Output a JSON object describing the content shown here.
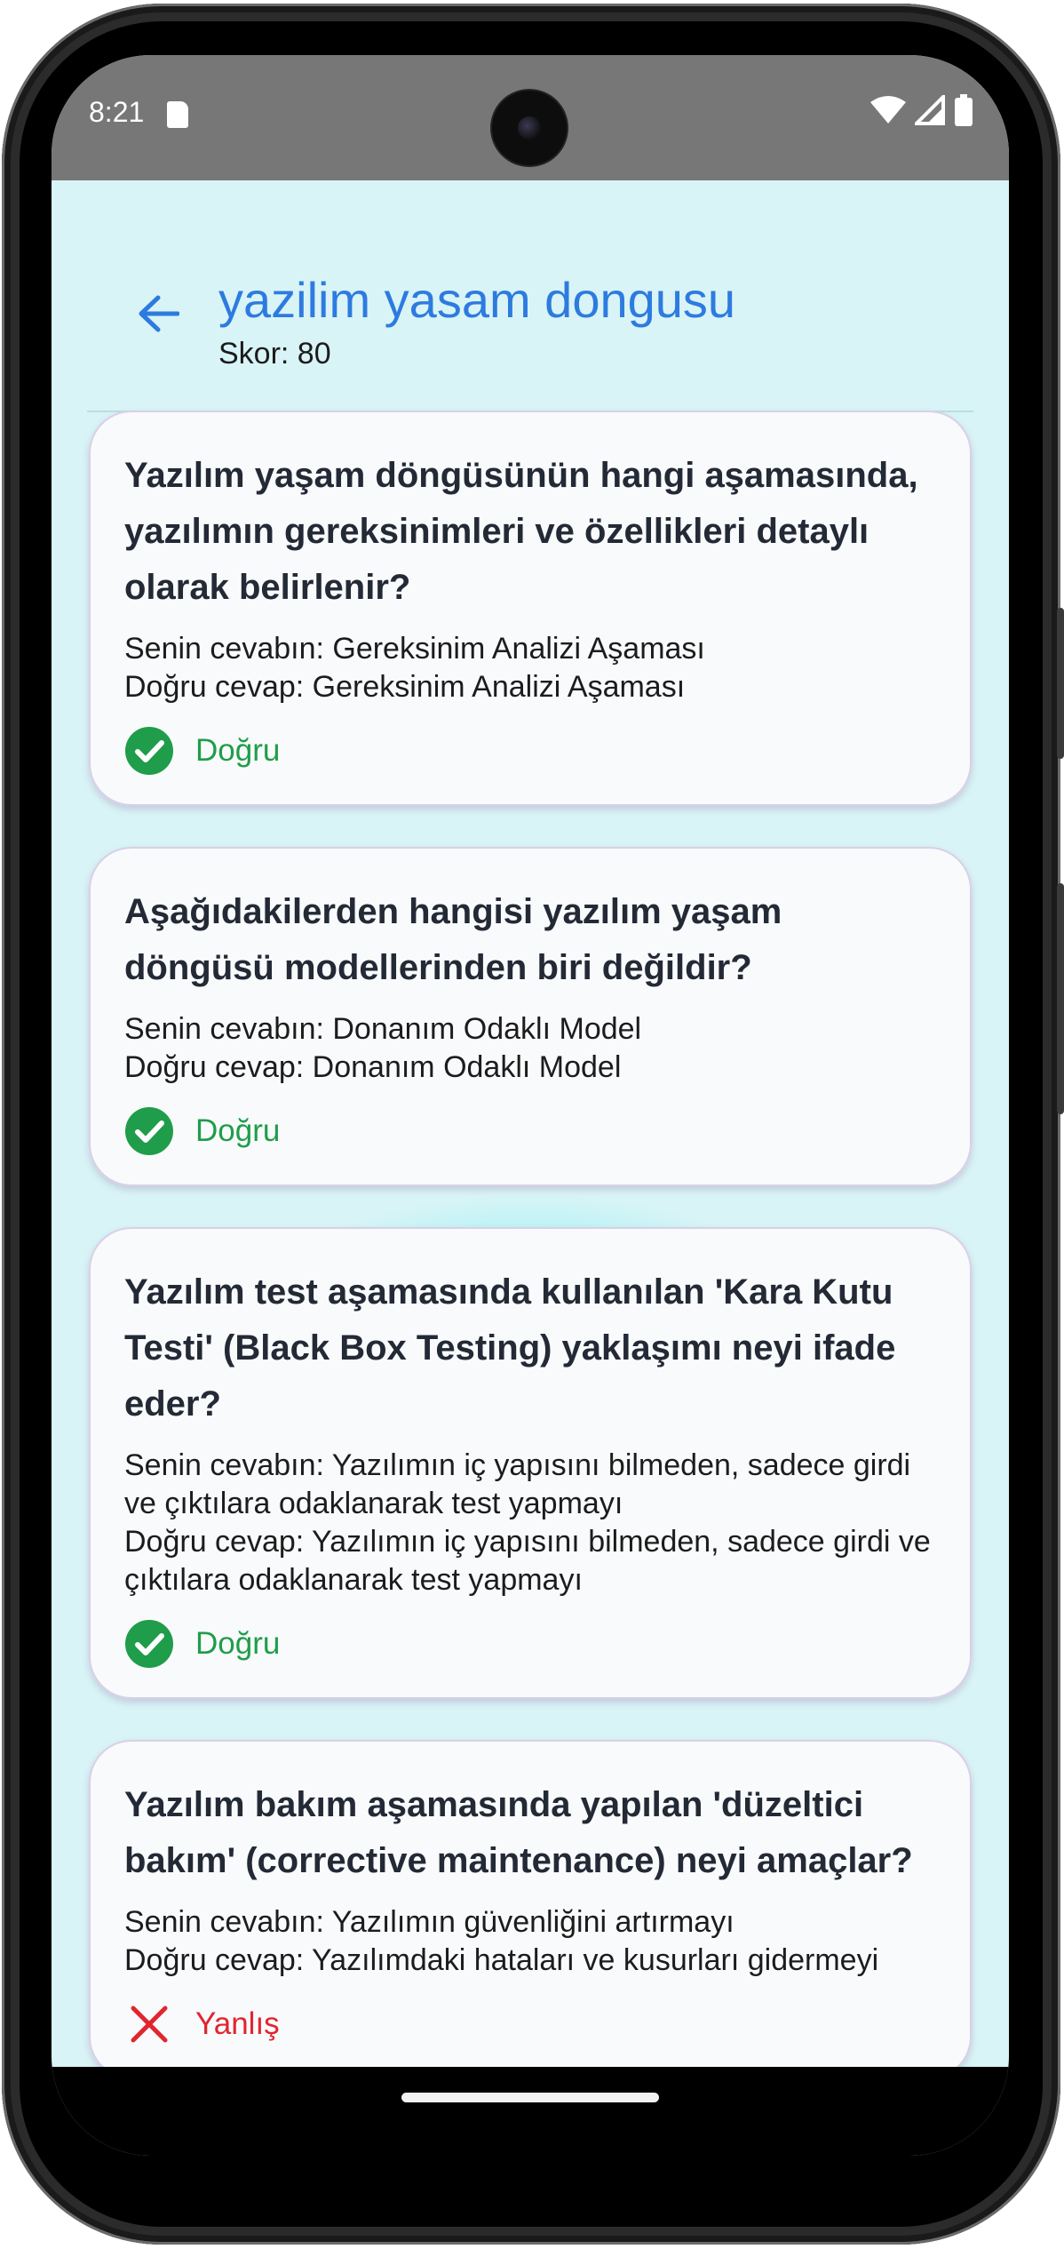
{
  "status_bar": {
    "time": "8:21",
    "icons": [
      "sd-card-icon",
      "wifi-icon",
      "signal-icon",
      "battery-icon"
    ]
  },
  "app_bar": {
    "back_icon": "arrow-left-icon",
    "title": "yazilim yasam dongusu",
    "score": "Skor: 80"
  },
  "colors": {
    "accent": "#2d7be0",
    "correct": "#1f9d4a",
    "wrong": "#e0262e",
    "background": "#d9f4f6",
    "card": "#f9fafc"
  },
  "results": [
    {
      "question": "Yazılım yaşam döngüsünün hangi aşamasında, yazılımın gereksinimleri ve özellikleri detaylı olarak belirlenir?",
      "your_answer": "Senin cevabın: Gereksinim Analizi Aşaması",
      "correct_answer": "Doğru cevap: Gereksinim Analizi Aşaması",
      "status": "Doğru",
      "status_icon": "check-circle-icon"
    },
    {
      "question": "Aşağıdakilerden hangisi yazılım yaşam döngüsü modellerinden biri değildir?",
      "your_answer": "Senin cevabın: Donanım Odaklı Model",
      "correct_answer": "Doğru cevap: Donanım Odaklı Model",
      "status": "Doğru",
      "status_icon": "check-circle-icon"
    },
    {
      "question": "Yazılım test aşamasında kullanılan 'Kara Kutu Testi' (Black Box Testing) yaklaşımı neyi ifade eder?",
      "your_answer": "Senin cevabın: Yazılımın iç yapısını bilmeden, sadece girdi ve çıktılara odaklanarak test yapmayı",
      "correct_answer": "Doğru cevap: Yazılımın iç yapısını bilmeden, sadece girdi ve çıktılara odaklanarak test yapmayı",
      "status": "Doğru",
      "status_icon": "check-circle-icon"
    },
    {
      "question": "Yazılım bakım aşamasında yapılan 'düzeltici bakım' (corrective maintenance) neyi amaçlar?",
      "your_answer": "Senin cevabın: Yazılımın güvenliğini artırmayı",
      "correct_answer": "Doğru cevap: Yazılımdaki hataları ve kusurları gidermeyi",
      "status": "Yanlış",
      "status_icon": "close-x-icon"
    }
  ]
}
